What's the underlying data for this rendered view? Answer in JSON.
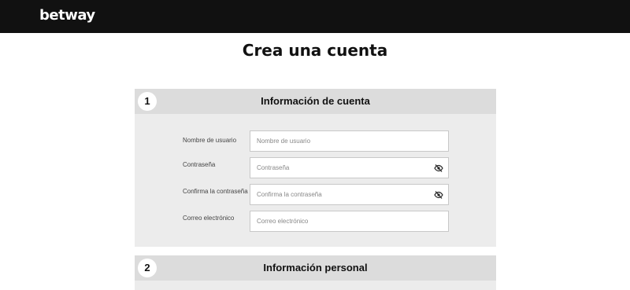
{
  "header": {
    "logo_text": "betway",
    "bg_color": "#111111"
  },
  "page": {
    "title": "Crea una cuenta"
  },
  "sections": [
    {
      "number": "1",
      "title": "Información de cuenta",
      "fields": [
        {
          "label": "Nombre de usuario",
          "placeholder": "Nombre de usuario",
          "value": "",
          "icon": null
        },
        {
          "label": "Contraseña",
          "placeholder": "Contraseña",
          "value": "",
          "icon": "eye-slash-icon"
        },
        {
          "label": "Confirma la contraseña",
          "placeholder": "Confirma la contraseña",
          "value": "",
          "icon": "eye-slash-icon"
        },
        {
          "label": "Correo electrónico",
          "placeholder": "Correo electrónico",
          "value": "",
          "icon": null
        }
      ]
    },
    {
      "number": "2",
      "title": "Información personal"
    }
  ]
}
